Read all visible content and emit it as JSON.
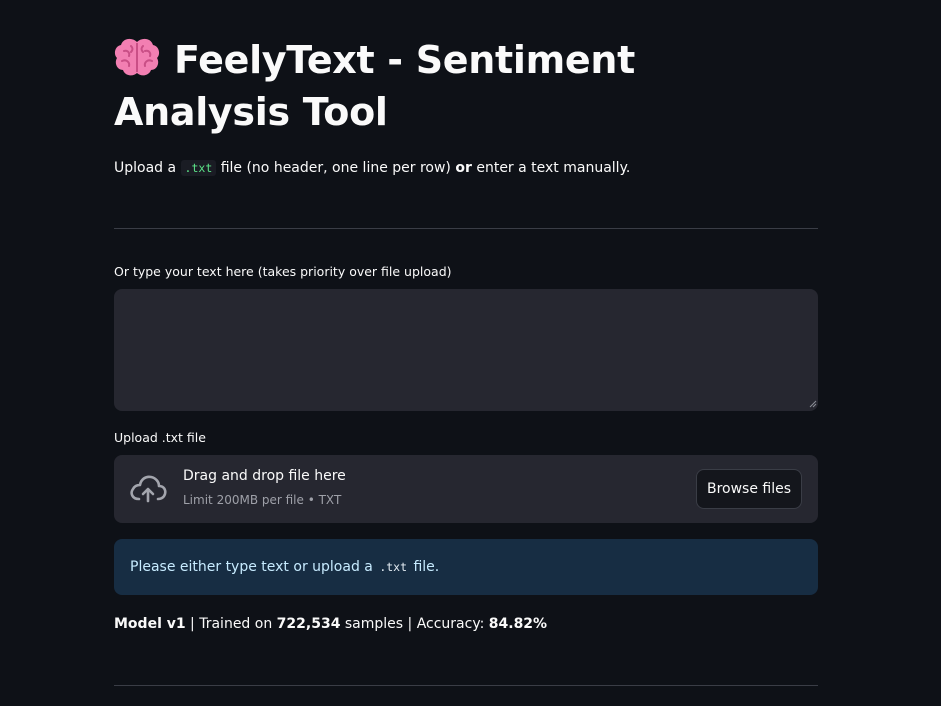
{
  "page": {
    "title": "FeelyText - Sentiment Analysis Tool",
    "title_icon": "brain-emoji"
  },
  "intro": {
    "prefix": "Upload a",
    "code": ".txt",
    "middle": "file (no header, one line per row)",
    "bold": "or",
    "suffix": "enter a text manually."
  },
  "text_input": {
    "label": "Or type your text here (takes priority over file upload)",
    "value": "",
    "placeholder": ""
  },
  "file_upload": {
    "label": "Upload .txt file",
    "drop_title": "Drag and drop file here",
    "drop_sub": "Limit 200MB per file • TXT",
    "browse_label": "Browse files",
    "icon": "cloud-upload-icon"
  },
  "info_alert": {
    "prefix": "Please either type text or upload a",
    "code": ".txt",
    "suffix": "file."
  },
  "model_info": {
    "model": "Model v1",
    "sep1": " | Trained on ",
    "samples": "722,534",
    "sep2": " samples | Accuracy: ",
    "accuracy": "84.82%"
  },
  "colors": {
    "background": "#0e1117",
    "input_bg": "#262730",
    "info_bg": "#172d43",
    "info_text": "#c7ebff",
    "code_green": "#5ce488"
  }
}
